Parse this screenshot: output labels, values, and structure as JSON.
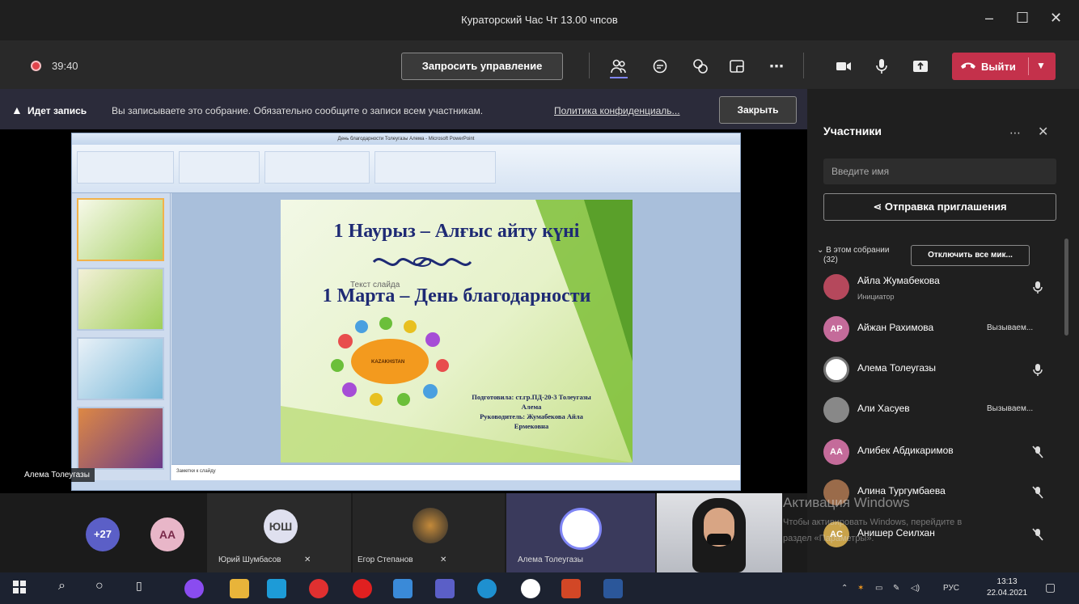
{
  "window": {
    "title": "Кураторский Час Чт 13.00 чпсов"
  },
  "toolbar": {
    "timer": "39:40",
    "request_control_label": "Запросить управление",
    "leave_label": "Выйти"
  },
  "banner": {
    "bold": "Идет запись",
    "text": "Вы записываете это собрание. Обязательно сообщите о записи всем участникам.",
    "policy_link": "Политика конфиденциаль...",
    "close_label": "Закрыть"
  },
  "stage": {
    "presenter_name": "Алема Толеугазы",
    "ppt": {
      "window_title": "День благодарности Толеугазы Алема - Microsoft PowerPoint",
      "notes_placeholder": "Заметки к слайду",
      "slide": {
        "title1": "1 Наурыз – Алғыс айту күні",
        "title2": "1 Марта – День благодарности",
        "ghost_placeholder": "Текст слайда",
        "kazakhstan": "KAZAKHSTAN",
        "credits": [
          "Подготовила: ст.гр.ПД-20-3 Толеугазы",
          "Алема",
          "Руководитель: Жумабекова Айла",
          "Ермековна"
        ]
      }
    }
  },
  "gallery": {
    "overflow_count": "+27",
    "tiles": [
      {
        "initials": "AA"
      },
      {
        "initials": "ЮШ",
        "name": "Юрий Шумбасов"
      },
      {
        "name": "Егор Степанов"
      },
      {
        "name": "Алема Толеугазы"
      }
    ]
  },
  "panel": {
    "title": "Участники",
    "search_placeholder": "Введите имя",
    "invite_label": "Отправка приглашения",
    "section_label": "В этом собрании",
    "section_count": "(32)",
    "mute_all_label": "Отключить все мик...",
    "participants": [
      {
        "name": "Айла Жумабекова",
        "role": "Инициатор",
        "status": "",
        "initials": "",
        "color": "#b5485c"
      },
      {
        "name": "Айжан Рахимова",
        "role": "",
        "status": "Вызываем...",
        "initials": "AP",
        "color": "#c46b9a"
      },
      {
        "name": "Алема Толеугазы",
        "role": "",
        "status": "",
        "initials": "",
        "color": "#ffffff"
      },
      {
        "name": "Али Хасуев",
        "role": "",
        "status": "Вызываем...",
        "initials": "",
        "color": "#888888"
      },
      {
        "name": "Алибек Абдикаримов",
        "role": "",
        "status": "",
        "initials": "AA",
        "color": "#c46b9a"
      },
      {
        "name": "Алина Тургумбаева",
        "role": "",
        "status": "",
        "initials": "",
        "color": "#9a6b4a"
      },
      {
        "name": "Анишер Сеилхан",
        "role": "",
        "status": "",
        "initials": "AC",
        "color": "#c8a24a"
      }
    ]
  },
  "watermark": {
    "line1": "Активация Windows",
    "line2": "Чтобы активировать Windows, перейдите в",
    "line3": "раздел «Параметры»."
  },
  "taskbar": {
    "lang": "РУС",
    "time": "13:13",
    "date": "22.04.2021"
  },
  "colors": {
    "leave_red": "#c4314b",
    "teams_purple": "#6264a7",
    "banner_bg": "#2b2b3a"
  }
}
